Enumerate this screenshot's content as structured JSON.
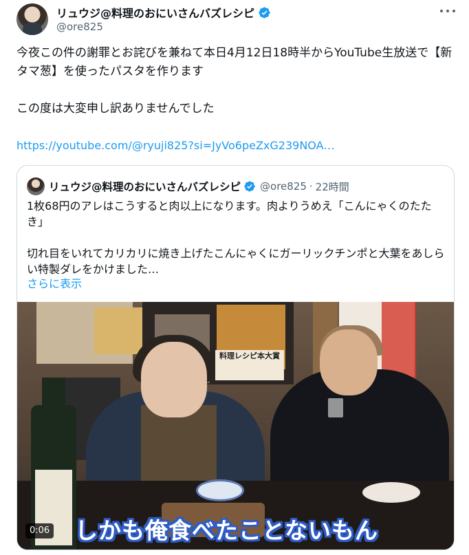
{
  "author": {
    "display_name": "リュウジ@料理のおにいさんバズレシピ",
    "handle": "@ore825",
    "verified": true
  },
  "icons": {
    "verified": "verified-badge-icon",
    "more": "more-options-icon"
  },
  "post": {
    "text": "今夜この件の謝罪とお詫びを兼ねて本日4月12日18時半からYouTube生放送で【新タマ葱】を使ったパスタを作ります\n\nこの度は大変申し訳ありませんでした",
    "link": "https://youtube.com/@ryuji825?si=JyVo6peZxG239NOA…"
  },
  "quote": {
    "display_name": "リュウジ@料理のおにいさんバズレシピ",
    "handle": "@ore825",
    "separator": "·",
    "time": "22時間",
    "text": "1枚68円のアレはこうすると肉以上になります。肉よりうめえ「こんにゃくのたたき」\n\n切れ目をいれてカリカリに焼き上げたこんにゃくにガーリックチンポと大葉をあしらい特製ダレをかけました…",
    "show_more": "さらに表示",
    "video": {
      "caption": "しかも俺食べたことないもん",
      "duration": "0:06",
      "poster_title": "料理レシピ本大賞"
    }
  },
  "colors": {
    "link": "#1d9bf0",
    "secondary_text": "#536471",
    "border": "#cfd9de",
    "caption_outline": "#2e5cc4"
  }
}
